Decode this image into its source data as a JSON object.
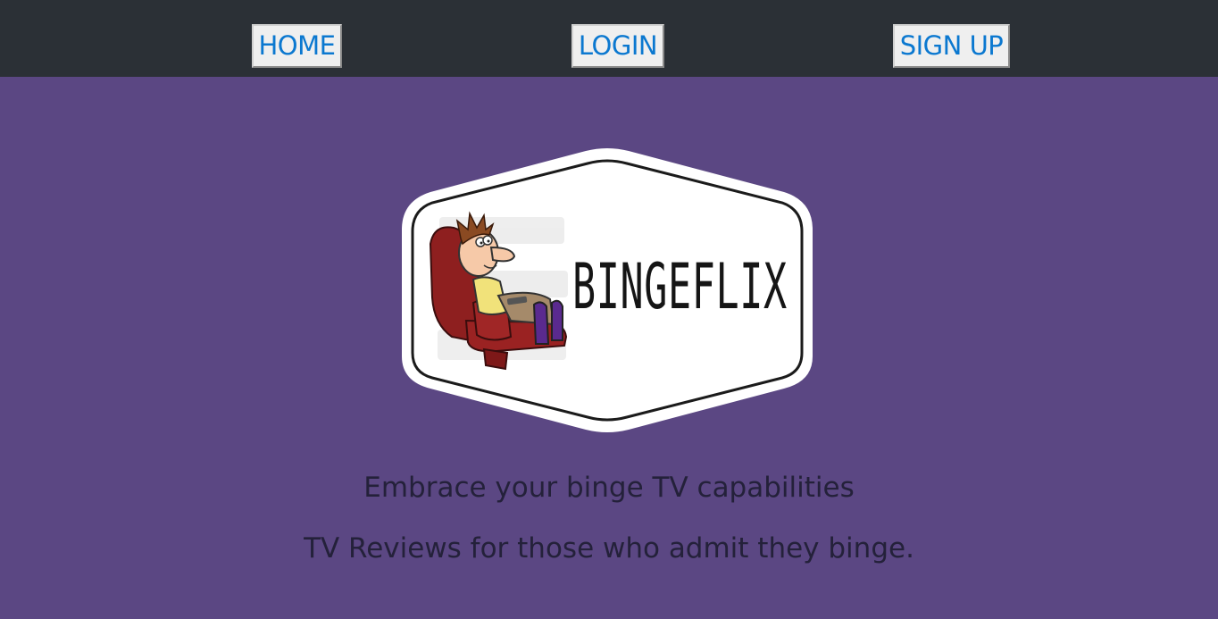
{
  "nav": {
    "home_label": "HOME",
    "login_label": "LOGIN",
    "signup_label": "SIGN UP"
  },
  "logo": {
    "text": "BINGEFLIX",
    "icon": "man-in-armchair-watching-tv-illustration"
  },
  "hero": {
    "tagline": "Embrace your binge TV capabilities",
    "subtitle": "TV Reviews for those who admit they binge."
  },
  "colors": {
    "topbar": "#2b3036",
    "background": "#5b4783",
    "nav_text": "#0b78d0",
    "button_bg": "#efefef",
    "body_text": "#24213a"
  }
}
